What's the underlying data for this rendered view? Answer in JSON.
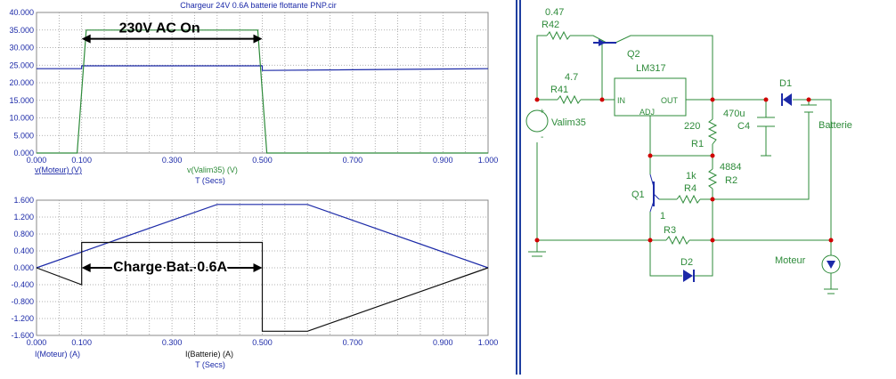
{
  "title": "Chargeur 24V 0.6A batterie flottante PNP.cir",
  "chart_data": [
    {
      "type": "line",
      "x_label": "T (Secs)",
      "xlim": [
        0,
        1
      ],
      "ylim": [
        0,
        40
      ],
      "y_ticks": [
        "0.000",
        "5.000",
        "10.000",
        "15.000",
        "20.000",
        "25.000",
        "30.000",
        "35.000",
        "40.000"
      ],
      "x_ticks": [
        "0.000",
        "0.100",
        "0.300",
        "0.500",
        "0.700",
        "0.900",
        "1.000"
      ],
      "x_tick_values": [
        0,
        0.1,
        0.3,
        0.5,
        0.7,
        0.9,
        1.0
      ],
      "series": [
        {
          "name": "v(Moteur) (V)",
          "color": "#1c2aa8",
          "x": [
            0,
            0.1,
            0.1,
            0.5,
            0.5,
            1.0
          ],
          "y": [
            24,
            24,
            24.8,
            24.8,
            23.5,
            24
          ]
        },
        {
          "name": "v(Valim35) (V)",
          "color": "#2e8b3a",
          "x": [
            0,
            0.09,
            0.11,
            0.49,
            0.51,
            1.0
          ],
          "y": [
            0,
            0,
            35,
            35,
            0,
            0
          ]
        }
      ],
      "annotation": "230V AC On",
      "annotation_span": [
        0.1,
        0.5
      ]
    },
    {
      "type": "line",
      "x_label": "T (Secs)",
      "xlim": [
        0,
        1
      ],
      "ylim": [
        -1.6,
        1.6
      ],
      "y_ticks": [
        "1.600",
        "1.200",
        "0.800",
        "0.400",
        "0.000",
        "-0.400",
        "-0.800",
        "-1.200",
        "-1.600"
      ],
      "x_ticks": [
        "0.000",
        "0.100",
        "0.300",
        "0.500",
        "0.700",
        "0.900",
        "1.000"
      ],
      "x_tick_values": [
        0,
        0.1,
        0.3,
        0.5,
        0.7,
        0.9,
        1.0
      ],
      "series": [
        {
          "name": "I(Moteur) (A)",
          "color": "#1c2aa8",
          "x": [
            0,
            0.4,
            0.6,
            1.0
          ],
          "y": [
            0,
            1.5,
            1.5,
            0
          ]
        },
        {
          "name": "I(Batterie) (A)",
          "color": "#111111",
          "x": [
            0,
            0.1,
            0.1,
            0.5,
            0.5,
            0.6,
            1.0
          ],
          "y": [
            0,
            -0.4,
            0.6,
            0.6,
            -1.5,
            -1.5,
            0
          ]
        }
      ],
      "annotation": "Charge Bat. 0.6A",
      "annotation_span": [
        0.1,
        0.5
      ]
    }
  ],
  "schematic": {
    "labels": {
      "r42_value": "0.47",
      "r42": "R42",
      "r41_value": "4.7",
      "r41": "R41",
      "q2": "Q2",
      "lm317": "LM317",
      "pin_in": "IN",
      "pin_out": "OUT",
      "pin_adj": "ADJ",
      "valim": "Valim35",
      "r1_value": "220",
      "r1": "R1",
      "c4_value": "470u",
      "c4": "C4",
      "r2_value": "4884",
      "r2": "R2",
      "r4_value": "1k",
      "r4": "R4",
      "q1": "Q1",
      "r3_value": "1",
      "r3": "R3",
      "d1": "D1",
      "d2": "D2",
      "batterie": "Batterie",
      "moteur": "Moteur",
      "plus": "+",
      "minus": "-"
    }
  }
}
